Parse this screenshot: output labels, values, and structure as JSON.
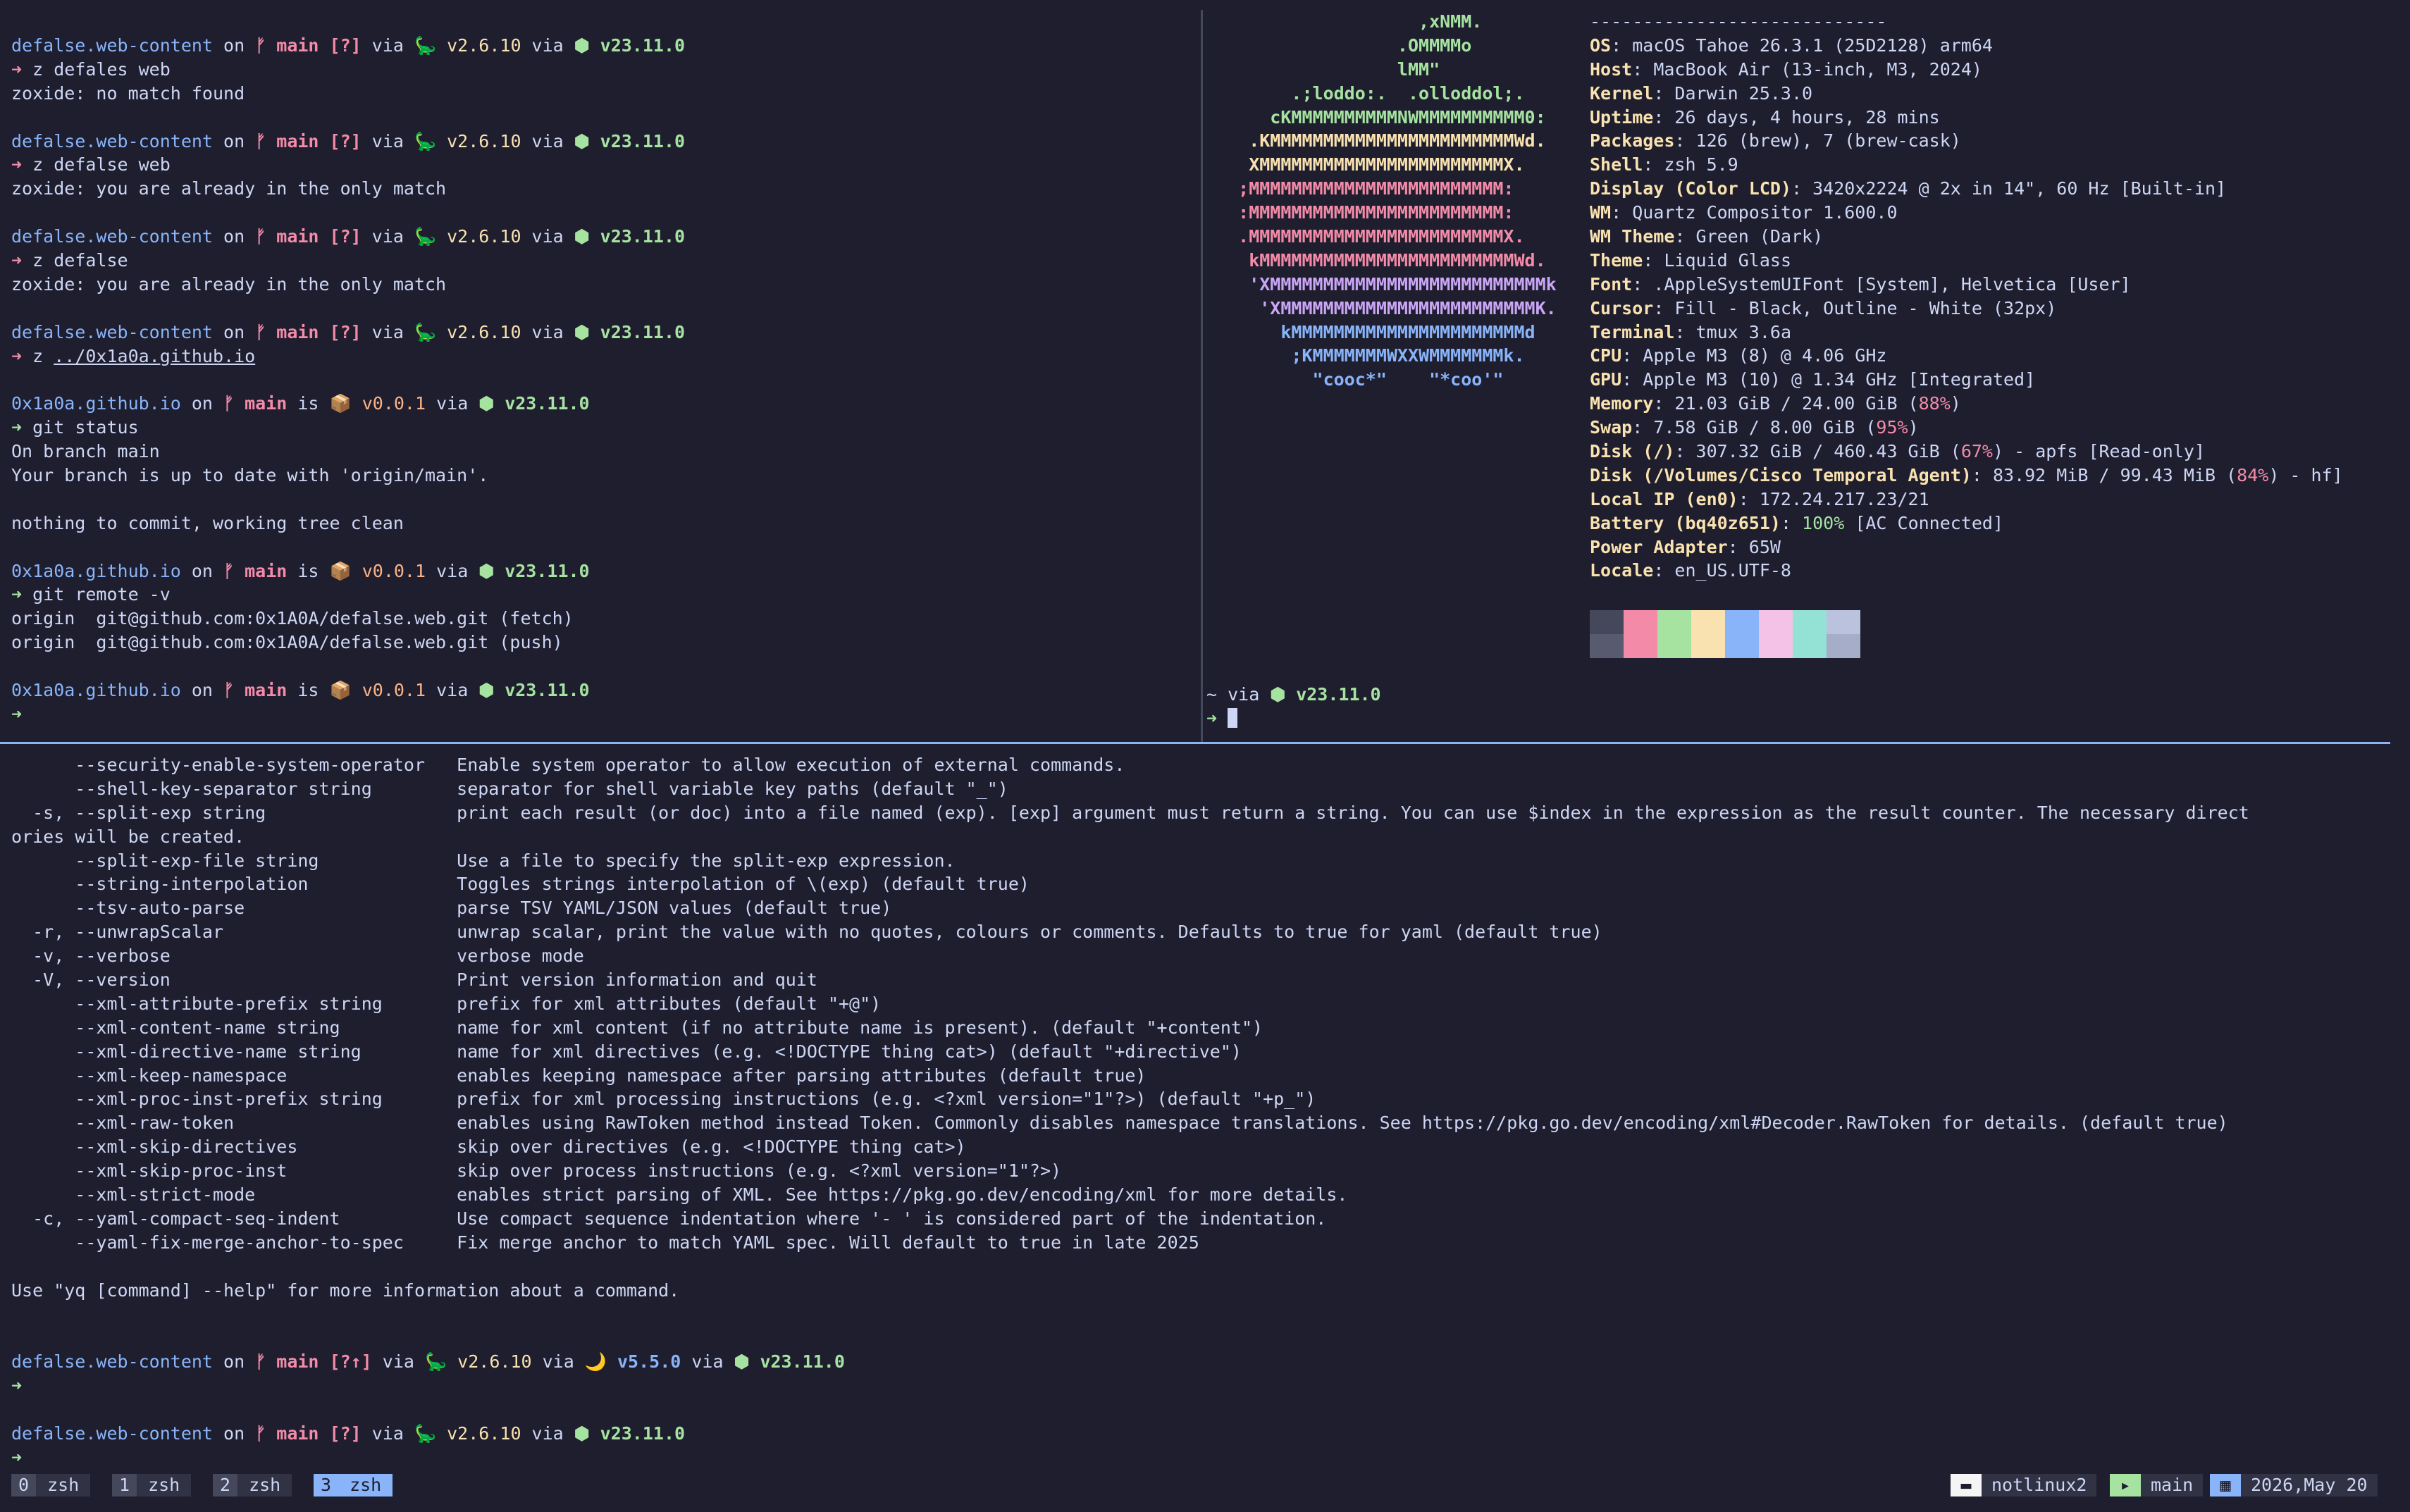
{
  "left_pane": {
    "blocks": [
      {
        "prompt": {
          "dir": "defalse.web-content",
          "sep1": " on ",
          "git": "ᚠ ",
          "branch": "main [?]",
          "sep2": " via ",
          "py": "🦕 v2.6.10",
          "sep3": " via ",
          "node": "⬢ v23.11.0"
        },
        "cmd_arrow": "➜",
        "cmd_arrow_err": true,
        "cmd": " z defales web",
        "output": [
          "zoxide: no match found"
        ]
      },
      {
        "prompt": {
          "dir": "defalse.web-content",
          "sep1": " on ",
          "git": "ᚠ ",
          "branch": "main [?]",
          "sep2": " via ",
          "py": "🦕 v2.6.10",
          "sep3": " via ",
          "node": "⬢ v23.11.0"
        },
        "cmd_arrow": "➜",
        "cmd_arrow_err": true,
        "cmd": " z defalse web",
        "output": [
          "zoxide: you are already in the only match"
        ]
      },
      {
        "prompt": {
          "dir": "defalse.web-content",
          "sep1": " on ",
          "git": "ᚠ ",
          "branch": "main [?]",
          "sep2": " via ",
          "py": "🦕 v2.6.10",
          "sep3": " via ",
          "node": "⬢ v23.11.0"
        },
        "cmd_arrow": "➜",
        "cmd_arrow_err": true,
        "cmd": " z defalse",
        "output": [
          "zoxide: you are already in the only match"
        ]
      },
      {
        "prompt": {
          "dir": "defalse.web-content",
          "sep1": " on ",
          "git": "ᚠ ",
          "branch": "main [?]",
          "sep2": " via ",
          "py": "🦕 v2.6.10",
          "sep3": " via ",
          "node": "⬢ v23.11.0"
        },
        "cmd_arrow": "➜",
        "cmd_arrow_err": true,
        "cmd": " z ",
        "cmd_ul": "../0x1a0a.github.io",
        "output": []
      },
      {
        "prompt": {
          "dir": "0x1a0a.github.io",
          "sep1": " on ",
          "git": "ᚠ ",
          "branch": "main",
          "sep2": " is ",
          "pkg": "📦 v0.0.1",
          "sep3": " via ",
          "node": "⬢ v23.11.0"
        },
        "cmd_arrow": "➜",
        "cmd_arrow_err": false,
        "cmd": " git status",
        "output": [
          "On branch main",
          "Your branch is up to date with 'origin/main'.",
          "",
          "nothing to commit, working tree clean"
        ]
      },
      {
        "prompt": {
          "dir": "0x1a0a.github.io",
          "sep1": " on ",
          "git": "ᚠ ",
          "branch": "main",
          "sep2": " is ",
          "pkg": "📦 v0.0.1",
          "sep3": " via ",
          "node": "⬢ v23.11.0"
        },
        "cmd_arrow": "➜",
        "cmd_arrow_err": false,
        "cmd": " git remote -v",
        "output": [
          "origin  git@github.com:0x1A0A/defalse.web.git (fetch)",
          "origin  git@github.com:0x1A0A/defalse.web.git (push)"
        ]
      },
      {
        "prompt": {
          "dir": "0x1a0a.github.io",
          "sep1": " on ",
          "git": "ᚠ ",
          "branch": "main",
          "sep2": " is ",
          "pkg": "📦 v0.0.1",
          "sep3": " via ",
          "node": "⬢ v23.11.0"
        },
        "cmd_arrow": "➜",
        "cmd_arrow_err": false,
        "cmd": "",
        "output": []
      }
    ]
  },
  "fastfetch": {
    "logo": [
      {
        "t": "                    ,xNMM.",
        "c": "#a6e3a1"
      },
      {
        "t": "                  .OMMMMo",
        "c": "#a6e3a1"
      },
      {
        "t": "                  lMM\"",
        "c": "#a6e3a1"
      },
      {
        "t": "        .;loddo:.  .olloddol;.",
        "c": "#a6e3a1"
      },
      {
        "t": "      cKMMMMMMMMMMNWMMMMMMMMMM0:",
        "c": "#a6e3a1"
      },
      {
        "t": "    .KMMMMMMMMMMMMMMMMMMMMMMMWd.",
        "c": "#f9e2af"
      },
      {
        "t": "    XMMMMMMMMMMMMMMMMMMMMMMMX.",
        "c": "#f9e2af"
      },
      {
        "t": "   ;MMMMMMMMMMMMMMMMMMMMMMMM:",
        "c": "#f38ba8"
      },
      {
        "t": "   :MMMMMMMMMMMMMMMMMMMMMMMM:",
        "c": "#f38ba8"
      },
      {
        "t": "   .MMMMMMMMMMMMMMMMMMMMMMMMX.",
        "c": "#f38ba8"
      },
      {
        "t": "    kMMMMMMMMMMMMMMMMMMMMMMMMWd.",
        "c": "#f38ba8"
      },
      {
        "t": "    'XMMMMMMMMMMMMMMMMMMMMMMMMMMk",
        "c": "#cba6f7"
      },
      {
        "t": "     'XMMMMMMMMMMMMMMMMMMMMMMMMK.",
        "c": "#cba6f7"
      },
      {
        "t": "       kMMMMMMMMMMMMMMMMMMMMMMd",
        "c": "#89b4fa"
      },
      {
        "t": "        ;KMMMMMMMWXXWMMMMMMMk.",
        "c": "#89b4fa"
      },
      {
        "t": "          \"cooc*\"    \"*coo'\"",
        "c": "#89b4fa"
      }
    ],
    "divider": "----------------------------",
    "rows": [
      {
        "k": "OS",
        "v": "macOS Tahoe 26.3.1 (25D2128) arm64"
      },
      {
        "k": "Host",
        "v": "MacBook Air (13-inch, M3, 2024)"
      },
      {
        "k": "Kernel",
        "v": "Darwin 25.3.0"
      },
      {
        "k": "Uptime",
        "v": "26 days, 4 hours, 28 mins"
      },
      {
        "k": "Packages",
        "v": "126 (brew), 7 (brew-cask)"
      },
      {
        "k": "Shell",
        "v": "zsh 5.9"
      },
      {
        "k": "Display (Color LCD)",
        "v": "3420x2224 @ 2x in 14\", 60 Hz [Built-in]"
      },
      {
        "k": "WM",
        "v": "Quartz Compositor 1.600.0"
      },
      {
        "k": "WM Theme",
        "v": "Green (Dark)"
      },
      {
        "k": "Theme",
        "v": "Liquid Glass"
      },
      {
        "k": "Font",
        "v": ".AppleSystemUIFont [System], Helvetica [User]"
      },
      {
        "k": "Cursor",
        "v": "Fill - Black, Outline - White (32px)"
      },
      {
        "k": "Terminal",
        "v": "tmux 3.6a"
      },
      {
        "k": "CPU",
        "v": "Apple M3 (8) @ 4.06 GHz"
      },
      {
        "k": "GPU",
        "v": "Apple M3 (10) @ 1.34 GHz [Integrated]"
      },
      {
        "k": "Memory",
        "v": "21.03 GiB / 24.00 GiB (",
        "p": "88%",
        "pc": "warn",
        "v2": ")"
      },
      {
        "k": "Swap",
        "v": "7.58 GiB / 8.00 GiB (",
        "p": "95%",
        "pc": "warn",
        "v2": ")"
      },
      {
        "k": "Disk (/)",
        "v": "307.32 GiB / 460.43 GiB (",
        "p": "67%",
        "pc": "warn",
        "v2": ") - apfs [Read-only]"
      },
      {
        "k": "Disk (/Volumes/Cisco Temporal Agent)",
        "v": "83.92 MiB / 99.43 MiB (",
        "p": "84%",
        "pc": "warn",
        "v2": ") - hf]"
      },
      {
        "k": "Local IP (en0)",
        "v": "172.24.217.23/21"
      },
      {
        "k": "Battery (bq40z651)",
        "v": "",
        "p": "100%",
        "pc": "ok",
        "v2": " [AC Connected]"
      },
      {
        "k": "Power Adapter",
        "v": "65W"
      },
      {
        "k": "Locale",
        "v": "en_US.UTF-8"
      }
    ],
    "palette_top": [
      "#45475a",
      "#f38ba8",
      "#a6e3a1",
      "#f9e2af",
      "#89b4fa",
      "#f5c2e7",
      "#94e2d5",
      "#bac2de"
    ],
    "palette_bottom": [
      "#585b70",
      "#f38ba8",
      "#a6e3a1",
      "#f9e2af",
      "#89b4fa",
      "#f5c2e7",
      "#94e2d5",
      "#a6adc8"
    ]
  },
  "shell_pane": {
    "prompt": "~ via ",
    "node": "⬢ v23.11.0",
    "arrow": "➜"
  },
  "bottom_pane": {
    "help_lines": [
      "      --security-enable-system-operator   Enable system operator to allow execution of external commands.",
      "      --shell-key-separator string        separator for shell variable key paths (default \"_\")",
      "  -s, --split-exp string                  print each result (or doc) into a file named (exp). [exp] argument must return a string. You can use $index in the expression as the result counter. The necessary direct",
      "ories will be created.",
      "      --split-exp-file string             Use a file to specify the split-exp expression.",
      "      --string-interpolation              Toggles strings interpolation of \\(exp) (default true)",
      "      --tsv-auto-parse                    parse TSV YAML/JSON values (default true)",
      "  -r, --unwrapScalar                      unwrap scalar, print the value with no quotes, colours or comments. Defaults to true for yaml (default true)",
      "  -v, --verbose                           verbose mode",
      "  -V, --version                           Print version information and quit",
      "      --xml-attribute-prefix string       prefix for xml attributes (default \"+@\")",
      "      --xml-content-name string           name for xml content (if no attribute name is present). (default \"+content\")",
      "      --xml-directive-name string         name for xml directives (e.g. <!DOCTYPE thing cat>) (default \"+directive\")",
      "      --xml-keep-namespace                enables keeping namespace after parsing attributes (default true)",
      "      --xml-proc-inst-prefix string       prefix for xml processing instructions (e.g. <?xml version=\"1\"?>) (default \"+p_\")",
      "      --xml-raw-token                     enables using RawToken method instead Token. Commonly disables namespace translations. See https://pkg.go.dev/encoding/xml#Decoder.RawToken for details. (default true)",
      "      --xml-skip-directives               skip over directives (e.g. <!DOCTYPE thing cat>)",
      "      --xml-skip-proc-inst                skip over process instructions (e.g. <?xml version=\"1\"?>)",
      "      --xml-strict-mode                   enables strict parsing of XML. See https://pkg.go.dev/encoding/xml for more details.",
      "  -c, --yaml-compact-seq-indent           Use compact sequence indentation where '- ' is considered part of the indentation.",
      "      --yaml-fix-merge-anchor-to-spec     Fix merge anchor to match YAML spec. Will default to true in late 2025",
      "",
      "Use \"yq [command] --help\" for more information about a command.",
      "",
      ""
    ],
    "prompt1": {
      "dir": "defalse.web-content",
      "sep1": " on ",
      "git": "ᚠ ",
      "branch": "main [?↑]",
      "sep2": " via ",
      "py": "🦕 v2.6.10",
      "sep3": " via ",
      "moon": "🌙 v5.5.0",
      "sep4": " via ",
      "node": "⬢ v23.11.0"
    },
    "prompt2": {
      "dir": "defalse.web-content",
      "sep1": " on ",
      "git": "ᚠ ",
      "branch": "main [?]",
      "sep2": " via ",
      "py": "🦕 v2.6.10",
      "sep3": " via ",
      "node": "⬢ v23.11.0"
    },
    "arrow": "➜"
  },
  "statusbar": {
    "windows": [
      {
        "idx": "0",
        "name": "zsh",
        "active": false
      },
      {
        "idx": "1",
        "name": "zsh",
        "active": false
      },
      {
        "idx": "2",
        "name": "zsh",
        "active": false
      },
      {
        "idx": "3",
        "name": "zsh",
        "active": true
      }
    ],
    "host_icon": "folder-icon",
    "host": "notlinux2",
    "branch_icon": "terminal-icon",
    "branch": "main",
    "date_icon": "calendar-icon",
    "date": "2026,May 20"
  }
}
